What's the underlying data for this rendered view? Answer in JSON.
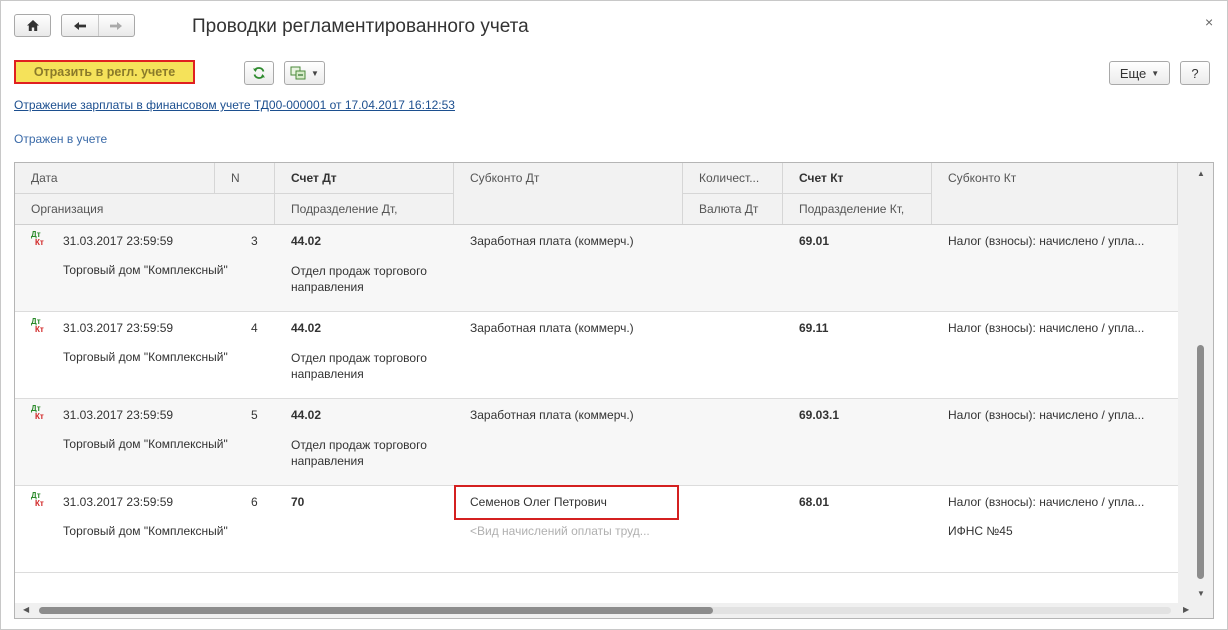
{
  "window": {
    "title": "Проводки регламентированного учета",
    "close_label": "×"
  },
  "toolbar": {
    "reflect_label": "Отразить в регл. учете",
    "more_label": "Еще",
    "help_label": "?"
  },
  "document_link": "Отражение зарплаты в финансовом учете ТД00-000001 от 17.04.2017 16:12:53",
  "status_text": "Отражен в учете",
  "columns": {
    "date": "Дата",
    "n": "N",
    "account_dt": "Счет Дт",
    "subconto_dt": "Субконто Дт",
    "quantity": "Количест...",
    "account_kt": "Счет Кт",
    "subconto_kt": "Субконто Кт",
    "organization": "Организация",
    "dept_dt": "Подразделение Дт,",
    "currency_dt": "Валюта Дт",
    "dept_kt": "Подразделение Кт,"
  },
  "rows": [
    {
      "icon_dt": "Дт",
      "icon_kt": "Кт",
      "date": "31.03.2017 23:59:59",
      "n": "3",
      "account_dt": "44.02",
      "subconto_dt": "Заработная плата (коммерч.)",
      "subconto_dt_2": "",
      "account_kt": "69.01",
      "subconto_kt": "Налог (взносы): начислено / упла...",
      "subconto_kt_2": "",
      "organization": "Торговый дом \"Комплексный\"",
      "dept_dt": "Отдел продаж торгового направления"
    },
    {
      "icon_dt": "Дт",
      "icon_kt": "Кт",
      "date": "31.03.2017 23:59:59",
      "n": "4",
      "account_dt": "44.02",
      "subconto_dt": "Заработная плата (коммерч.)",
      "subconto_dt_2": "",
      "account_kt": "69.11",
      "subconto_kt": "Налог (взносы): начислено / упла...",
      "subconto_kt_2": "",
      "organization": "Торговый дом \"Комплексный\"",
      "dept_dt": "Отдел продаж торгового направления"
    },
    {
      "icon_dt": "Дт",
      "icon_kt": "Кт",
      "date": "31.03.2017 23:59:59",
      "n": "5",
      "account_dt": "44.02",
      "subconto_dt": "Заработная плата (коммерч.)",
      "subconto_dt_2": "",
      "account_kt": "69.03.1",
      "subconto_kt": "Налог (взносы): начислено / упла...",
      "subconto_kt_2": "",
      "organization": "Торговый дом \"Комплексный\"",
      "dept_dt": "Отдел продаж торгового направления"
    },
    {
      "icon_dt": "Дт",
      "icon_kt": "Кт",
      "date": "31.03.2017 23:59:59",
      "n": "6",
      "account_dt": "70",
      "subconto_dt": "Семенов Олег Петрович",
      "subconto_dt_2": "<Вид начислений оплаты труд...",
      "account_kt": "68.01",
      "subconto_kt": "Налог (взносы): начислено / упла...",
      "subconto_kt_2": "ИФНС №45",
      "organization": "Торговый дом \"Комплексный\"",
      "dept_dt": ""
    }
  ],
  "colors": {
    "highlight": "#d42020",
    "reflect_button_bg": "#f5e25a",
    "link": "#1c4f8f"
  }
}
